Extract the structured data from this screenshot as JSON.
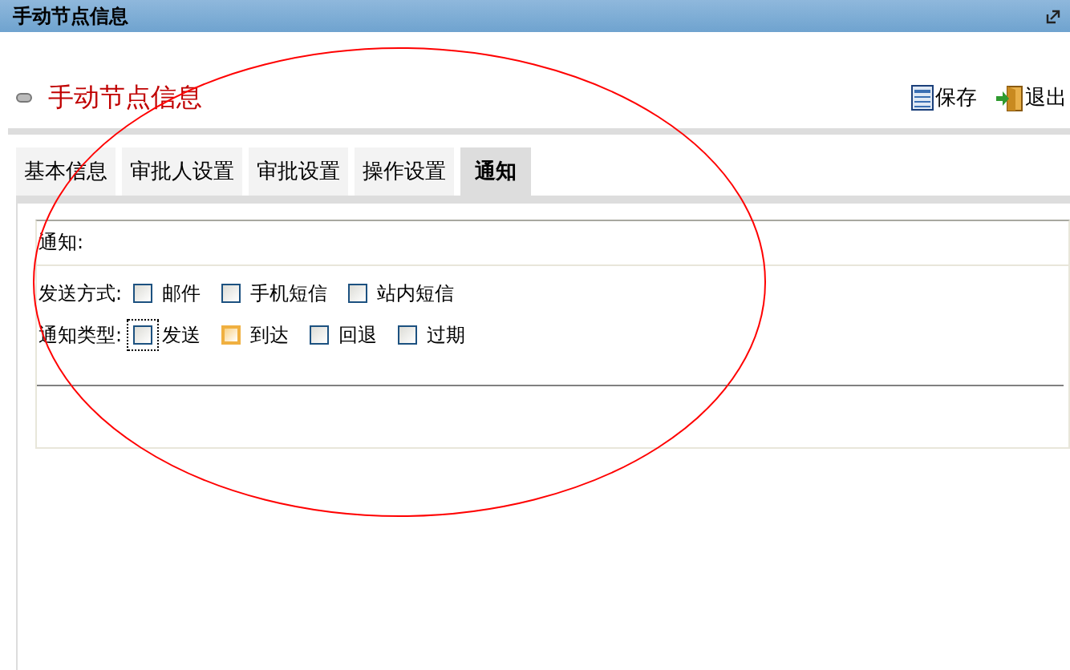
{
  "window": {
    "title": "手动节点信息"
  },
  "header": {
    "title": "手动节点信息",
    "actions": [
      {
        "kind": "save",
        "label": "保存"
      },
      {
        "kind": "exit",
        "label": "退出"
      }
    ]
  },
  "tabs": [
    {
      "label": "基本信息",
      "selected": false
    },
    {
      "label": "审批人设置",
      "selected": false
    },
    {
      "label": "审批设置",
      "selected": false
    },
    {
      "label": "操作设置",
      "selected": false
    },
    {
      "label": "通知",
      "selected": true
    }
  ],
  "panel": {
    "heading": "通知:",
    "groups": [
      {
        "label": "发送方式:",
        "options": [
          {
            "label": "邮件",
            "checked": false,
            "hovered": false,
            "focused": false
          },
          {
            "label": "手机短信",
            "checked": false,
            "hovered": false,
            "focused": false
          },
          {
            "label": "站内短信",
            "checked": false,
            "hovered": false,
            "focused": false
          }
        ]
      },
      {
        "label": "通知类型:",
        "options": [
          {
            "label": "发送",
            "checked": false,
            "hovered": false,
            "focused": true
          },
          {
            "label": "到达",
            "checked": false,
            "hovered": true,
            "focused": false
          },
          {
            "label": "回退",
            "checked": false,
            "hovered": false,
            "focused": false
          },
          {
            "label": "过期",
            "checked": false,
            "hovered": false,
            "focused": false
          }
        ]
      }
    ]
  },
  "annotation": {
    "kind": "ellipse"
  }
}
